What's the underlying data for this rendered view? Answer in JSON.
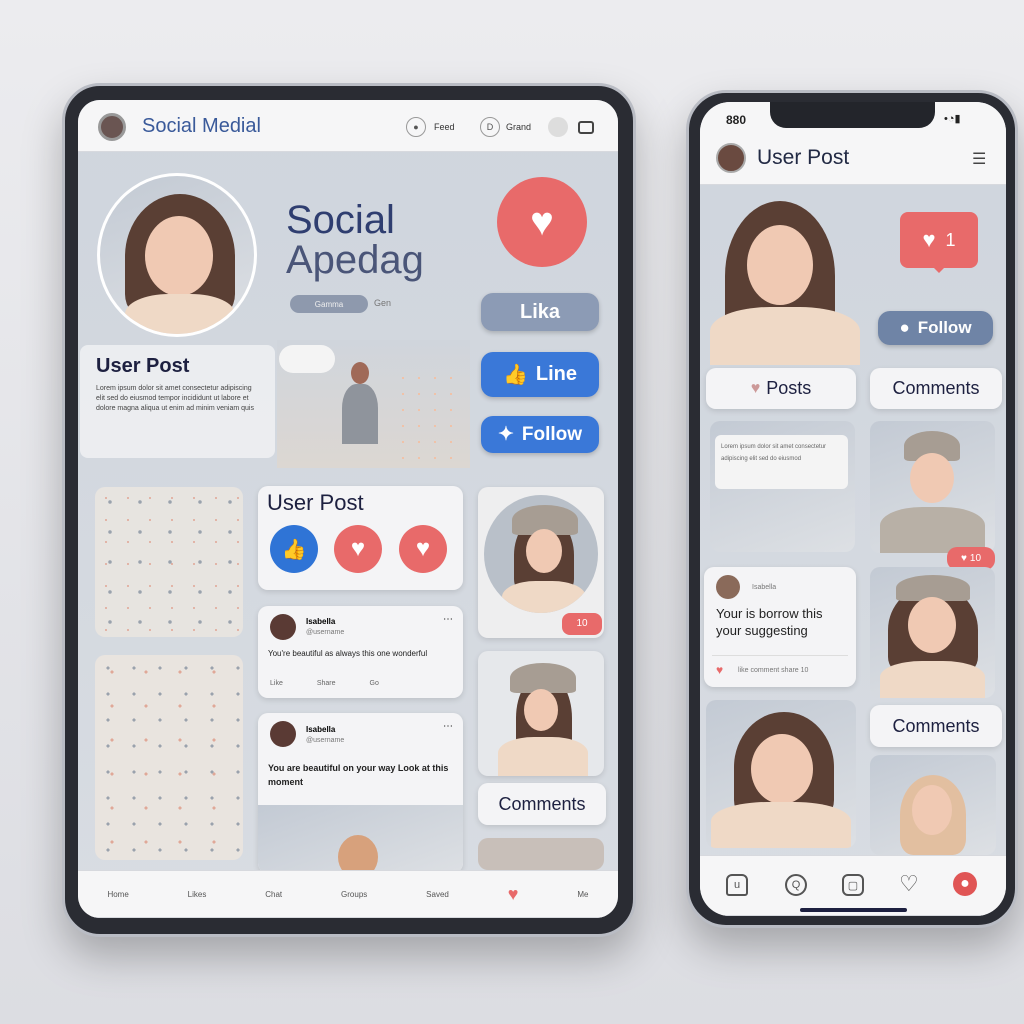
{
  "tablet": {
    "header": {
      "title": "Social Medial",
      "nav": [
        {
          "label": "Feed",
          "icon": "record-icon"
        },
        {
          "label": "Grand",
          "icon": "d-icon"
        }
      ],
      "icons": [
        "profile-icon",
        "window-icon"
      ]
    },
    "hero": {
      "title_line1": "Social",
      "title_line2": "Apedag",
      "chip_label": "Gamma",
      "chip_meta": "Gen"
    },
    "buttons": {
      "like": "Lika",
      "line": "Line",
      "follow": "Follow"
    },
    "user_post_intro": {
      "title": "User Post",
      "text": "Lorem ipsum dolor sit amet consectetur adipiscing elit sed do eiusmod tempor incididunt ut labore et dolore magna aliqua ut enim ad minim veniam quis"
    },
    "reaction_card": {
      "title": "User Post"
    },
    "posts": [
      {
        "author": "Isabella",
        "handle": "@username",
        "text": "You're beautiful as always this one wonderful",
        "actions": [
          "Like",
          "Share",
          "Go"
        ]
      },
      {
        "author": "Isabella",
        "handle": "@username",
        "text": "You are beautiful on your way Look at this moment"
      }
    ],
    "photo_badge": "10",
    "comments_label": "Comments",
    "bottom_nav": [
      "Home",
      "Likes",
      "Chat",
      "Groups",
      "Saved",
      "Love",
      "Me"
    ]
  },
  "phone": {
    "status": {
      "time": "880"
    },
    "header": {
      "title": "User Post"
    },
    "like_bubble": {
      "count": "1"
    },
    "follow_label": "Follow",
    "posts_chip": "Posts",
    "comments_chip": "Comments",
    "comments_chip2": "Comments",
    "text_card": "Lorem ipsum dolor sit amet consectetur adipiscing elit sed do eiusmod",
    "photo_badge": "10",
    "post": {
      "author": "Isabella",
      "text": "Your is borrow this your suggesting",
      "meta": "like comment share 10"
    },
    "bottom_nav": [
      "home-icon",
      "search-icon",
      "camera-icon",
      "heart-icon",
      "notification-icon"
    ]
  },
  "colors": {
    "accent_blue": "#3a78d8",
    "accent_red": "#e86a6a",
    "header_text": "#3a5a9a"
  }
}
